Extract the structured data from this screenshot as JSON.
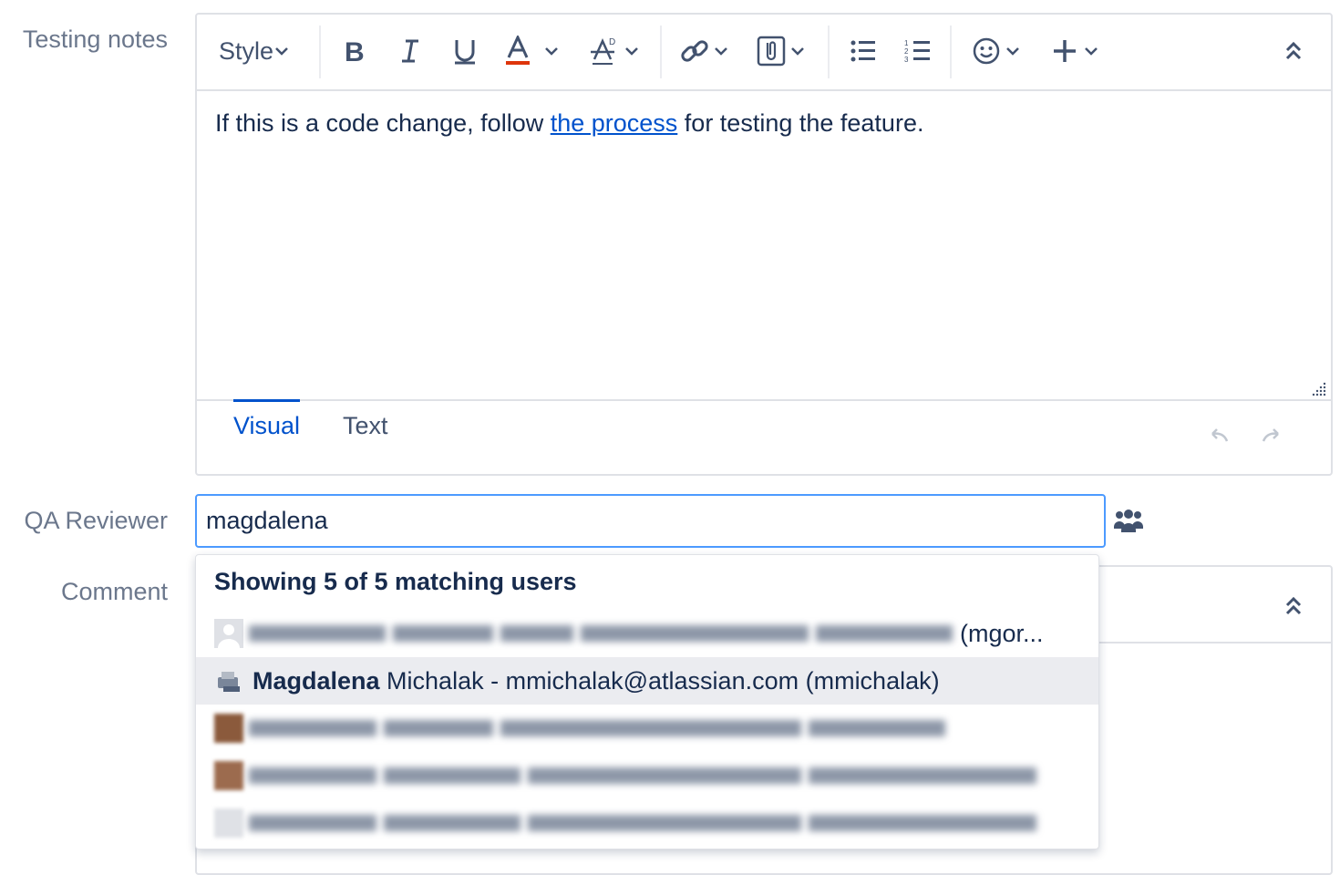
{
  "testing_notes": {
    "label": "Testing notes",
    "toolbar": {
      "style_label": "Style",
      "buttons": [
        "bold",
        "italic",
        "underline",
        "text-color",
        "clear-formatting",
        "link",
        "attachment",
        "bullet-list",
        "numbered-list",
        "emoji",
        "insert-more",
        "collapse-toolbar"
      ]
    },
    "content": {
      "before": "If this is a code change, follow ",
      "link": "the process",
      "after": " for testing the feature."
    },
    "tabs": [
      {
        "label": "Visual",
        "active": true
      },
      {
        "label": "Text",
        "active": false
      }
    ]
  },
  "qa_reviewer": {
    "label": "QA Reviewer",
    "value": "magdalena"
  },
  "comment": {
    "label": "Comment"
  },
  "dropdown": {
    "header": "Showing 5 of 5 matching users",
    "results": [
      {
        "suffix": "(mgor...",
        "blurred": true
      },
      {
        "name_bold": "Magdalena",
        "rest": " Michalak - mmichalak@atlassian.com (mmichalak)",
        "highlighted": true
      },
      {
        "blurred": true
      },
      {
        "blurred": true
      },
      {
        "blurred": true
      }
    ]
  },
  "colors": {
    "link": "#0052cc",
    "focus_border": "#4c9aff",
    "text_color_underline": "#de350b"
  }
}
